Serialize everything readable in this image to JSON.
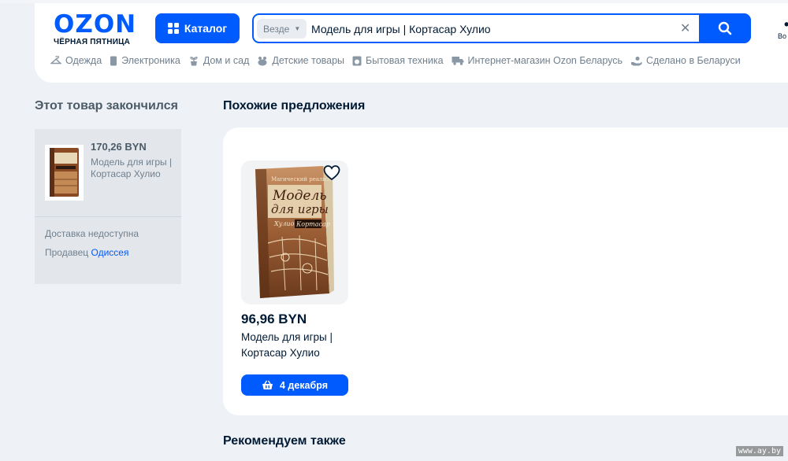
{
  "header": {
    "logo_text": "OZON",
    "logo_subtitle": "ЧЁРНАЯ ПЯТНИЦА",
    "catalog_label": "Каталог",
    "search": {
      "scope": "Везде",
      "query": "Модель для игры | Кортасар Хулио"
    },
    "user_label": "Во"
  },
  "nav": {
    "items": [
      {
        "label": "Одежда",
        "icon": "hanger-icon"
      },
      {
        "label": "Электроника",
        "icon": "phone-icon"
      },
      {
        "label": "Дом и сад",
        "icon": "plant-icon"
      },
      {
        "label": "Детские товары",
        "icon": "toy-icon"
      },
      {
        "label": "Бытовая техника",
        "icon": "appliance-icon"
      },
      {
        "label": "Интернет-магазин Ozon Беларусь",
        "icon": "truck-icon"
      },
      {
        "label": "Сделано в Беларуси",
        "icon": "hand-icon"
      }
    ]
  },
  "out_of_stock": {
    "title": "Этот товар закончился",
    "price": "170,26 BYN",
    "name": "Модель для игры | Кортасар Хулио",
    "delivery": "Доставка недоступна",
    "seller_prefix": "Продавец",
    "seller_name": "Одиссея"
  },
  "similar": {
    "title": "Похожие предложения",
    "products": [
      {
        "price": "96,96 BYN",
        "name": "Модель для игры | Кортасар Хулио",
        "delivery_button": "4 декабря",
        "book_series": "Магический реализм",
        "book_title_line1": "Модель",
        "book_title_line2": "для игры",
        "book_author_first": "Хулио",
        "book_author_last": "Кортасар"
      }
    ]
  },
  "recommend_title": "Рекомендуем также",
  "watermark": "www.ay.by",
  "colors": {
    "accent": "#005bff",
    "page_bg": "#eef1f6",
    "text_primary": "#001a34",
    "text_secondary": "#707f8d"
  }
}
